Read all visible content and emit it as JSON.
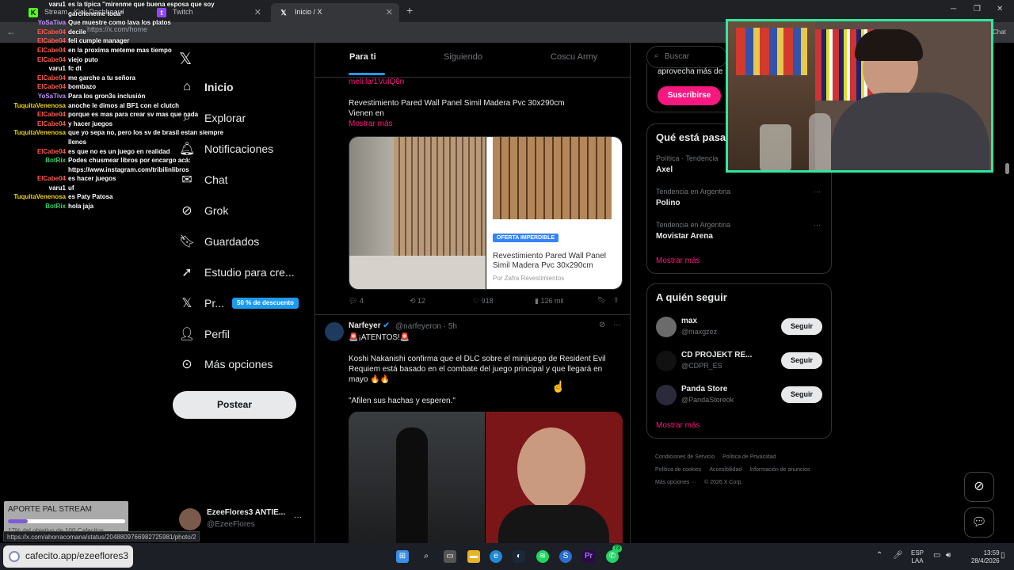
{
  "browser": {
    "tabs": [
      {
        "label": "Stream - Kick Dashboard",
        "icon": "kick-icon"
      },
      {
        "label": "Twitch",
        "icon": "twitch-icon"
      },
      {
        "label": "Inicio / X",
        "icon": "x-icon"
      }
    ],
    "url": "https://x.com/home",
    "status_url": "https://x.com/ahorracomana/status/2048809766982725981/photo/2",
    "chat_label": "Chat"
  },
  "chat": [
    {
      "user": "varu1",
      "color": "#ffffff",
      "text": "es la tipica ''mirenme que buena esposa que soy garcheneme toda''"
    },
    {
      "user": "YoSaTiva",
      "color": "#c08cff",
      "text": "Que muestre como lava los platos"
    },
    {
      "user": "ElCabe04",
      "color": "#ff5a4a",
      "text": "decile"
    },
    {
      "user": "ElCabe04",
      "color": "#ff5a4a",
      "text": "feli cumple manager"
    },
    {
      "user": "ElCabe04",
      "color": "#ff5a4a",
      "text": "en la proxima meteme mas tiempo"
    },
    {
      "user": "ElCabe04",
      "color": "#ff5a4a",
      "text": "viejo puto"
    },
    {
      "user": "varu1",
      "color": "#ffffff",
      "text": "fc dt"
    },
    {
      "user": "ElCabe04",
      "color": "#ff5a4a",
      "text": "me garche a tu señora"
    },
    {
      "user": "ElCabe04",
      "color": "#ff5a4a",
      "text": "bombazo"
    },
    {
      "user": "YoSaTiva",
      "color": "#c08cff",
      "text": "Para los gron3s inclusión"
    },
    {
      "user": "TuquitaVenenosa",
      "color": "#f0d000",
      "text": "anoche le dimos al BF1 con el clutch"
    },
    {
      "user": "ElCabe04",
      "color": "#ff5a4a",
      "text": "porque es mas para crear sv mas que nada"
    },
    {
      "user": "ElCabe04",
      "color": "#ff5a4a",
      "text": "y hacer juegos"
    },
    {
      "user": "TuquitaVenenosa",
      "color": "#f0d000",
      "text": "que yo sepa no, pero los sv de brasil estan siempre llenos"
    },
    {
      "user": "ElCabe04",
      "color": "#ff5a4a",
      "text": "es que no es un juego en realidad"
    },
    {
      "user": "BotRix",
      "color": "#3ad06a",
      "text": "Podes chusmear libros por encargo acá: https://www.instagram.com/tribilinlibros"
    },
    {
      "user": "ElCabe04",
      "color": "#ff5a4a",
      "text": "es hacer juegos"
    },
    {
      "user": "varu1",
      "color": "#ffffff",
      "text": "uf"
    },
    {
      "user": "TuquitaVenenosa",
      "color": "#f0d000",
      "text": "es Paty Patosa"
    },
    {
      "user": "BotRix",
      "color": "#3ad06a",
      "text": "hola jaja"
    }
  ],
  "sidebar": {
    "items": [
      {
        "label": "Inicio",
        "icon": "home-icon",
        "bold": true
      },
      {
        "label": "Explorar",
        "icon": "search-icon"
      },
      {
        "label": "Notificaciones",
        "icon": "bell-icon"
      },
      {
        "label": "Chat",
        "icon": "chat-icon"
      },
      {
        "label": "Grok",
        "icon": "grok-icon"
      },
      {
        "label": "Guardados",
        "icon": "bookmark-icon"
      },
      {
        "label": "Estudio para cre...",
        "icon": "rocket-icon"
      },
      {
        "label": "Pr...",
        "icon": "x-premium-icon"
      },
      {
        "label": "Perfil",
        "icon": "person-icon"
      },
      {
        "label": "Más opciones",
        "icon": "more-circle-icon"
      }
    ],
    "premium_badge": "50 % de descuento",
    "post_button": "Postear",
    "account": {
      "name": "EzeeFlores3 ANTIE...",
      "handle": "@EzeeFlores"
    }
  },
  "feed": {
    "tabs": [
      "Para ti",
      "Siguiendo",
      "Coscu Army"
    ],
    "tweet1": {
      "link": "meli.la/1VulQ6n",
      "text": "Revestimiento Pared Wall Panel Simil Madera Pvc 30x290cm\nVienen en",
      "show_more": "Mostrar más",
      "offer_badge": "OFERTA IMPERDIBLE",
      "product_title": "Revestimiento Pared Wall Panel Simil Madera Pvc 30x290cm",
      "product_seller": "Por Zafra Revestimientos",
      "replies": "4",
      "reposts": "12",
      "likes": "918",
      "views": "126 mil"
    },
    "tweet2": {
      "author": "Narfeyer",
      "handle": "@narfeyeron · 5h",
      "headline": "🚨¡ATENTOS!🚨",
      "text": "Koshi Nakanishi confirma que el DLC sobre el minijuego de Resident Evil Requiem está basado en el combate del juego principal y que llegará en mayo 🔥🔥",
      "quote": "\"Afilen sus hachas y esperen.\""
    }
  },
  "right": {
    "search_placeholder": "Buscar",
    "premium_text": "aprovecha más de",
    "subscribe": "Suscribirse",
    "trends_title": "Qué está pasando",
    "trends": [
      {
        "context": "Política · Tendencia",
        "name": "Axel"
      },
      {
        "context": "Tendencia en Argentina",
        "name": "Polino"
      },
      {
        "context": "Tendencia en Argentina",
        "name": "Movistar Arena"
      }
    ],
    "show_more": "Mostrar más",
    "follow_title": "A quién seguir",
    "suggestions": [
      {
        "name": "max",
        "handle": "@maxgzez"
      },
      {
        "name": "CD PROJEKT RE...",
        "handle": "@CDPR_ES"
      },
      {
        "name": "Panda Store",
        "handle": "@PandaStoreok"
      }
    ],
    "follow_label": "Seguir",
    "footer": [
      "Condiciones de Servicio",
      "Política de Privacidad",
      "Política de cookies",
      "Accesibilidad",
      "Información de anuncios",
      "Más opciones ···",
      "© 2026 X Corp."
    ]
  },
  "overlay": {
    "goal_title": "APORTE PAL STREAM",
    "goal_text": "17% del objetivo de 100 Cafecitos",
    "goal_progress": 0.17,
    "cafecito": "cafecito.app/ezeeflores3"
  },
  "taskbar": {
    "lang1": "ESP",
    "lang2": "LAA",
    "time": "13:59",
    "date": "28/4/2026",
    "whatsapp_count": "73"
  }
}
